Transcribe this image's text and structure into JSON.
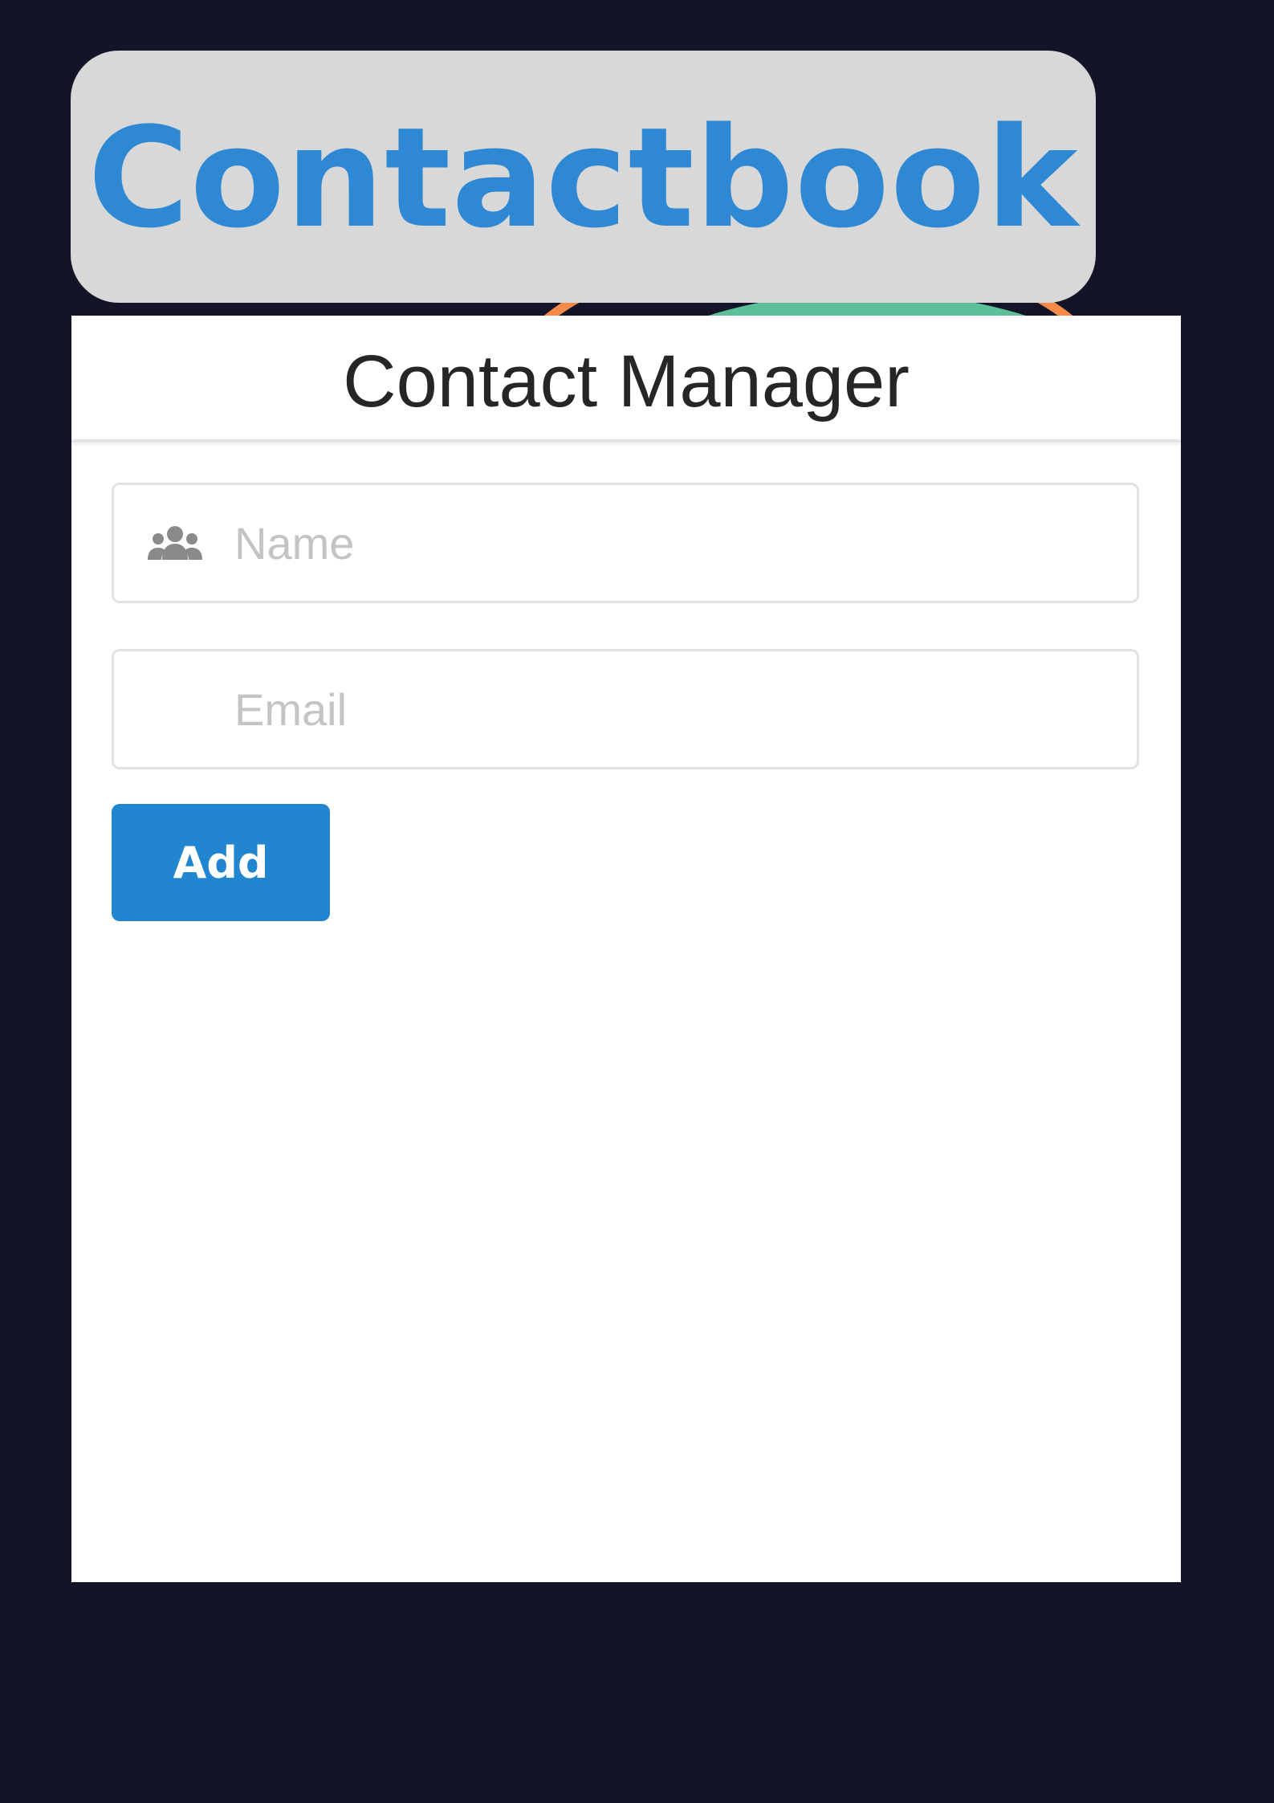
{
  "banner": {
    "title": "Contactbook"
  },
  "card": {
    "title": "Contact Manager"
  },
  "form": {
    "name_placeholder": "Name",
    "name_value": "",
    "email_placeholder": "Email",
    "email_value": "",
    "add_label": "Add"
  },
  "icons": {
    "name_field_icon": "users-icon"
  },
  "colors": {
    "background": "#141428",
    "banner_background": "#d8d8d8",
    "brand_blue": "#2e88d4",
    "button_blue": "#2185d0",
    "accent_orange": "#f58a4b",
    "accent_green": "#5bbf98"
  }
}
